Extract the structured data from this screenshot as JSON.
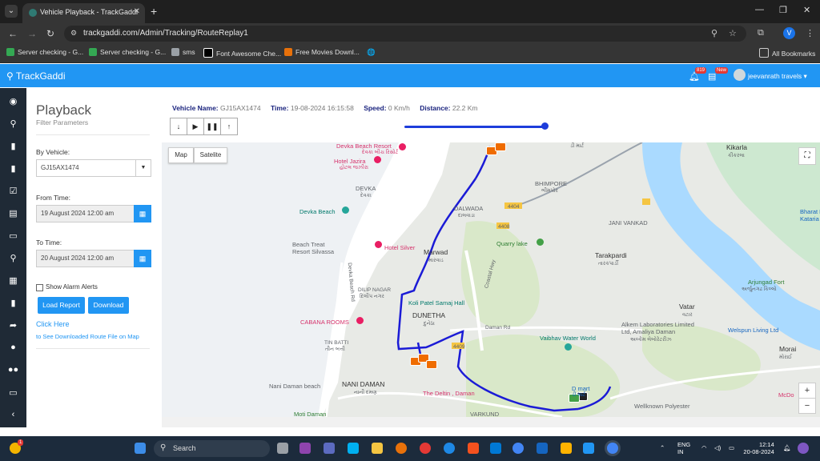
{
  "browser": {
    "tab_title": "Vehicle Playback - TrackGaddi",
    "url": "trackgaddi.com/Admin/Tracking/RouteReplay1",
    "profile_initial": "V",
    "bookmarks": [
      "Server checking - G...",
      "Server checking - G...",
      "sms",
      "Font Awesome Che...",
      "Free Movies Downl..."
    ],
    "all_bookmarks": "All Bookmarks"
  },
  "header": {
    "brand": "TrackGaddi",
    "alert_badge": "819",
    "new_badge": "New",
    "user": "jeevanrath travels"
  },
  "filter": {
    "title": "Playback",
    "subtitle": "Filter Parameters",
    "vehicle_label": "By Vehicle:",
    "vehicle_value": "GJ15AX1474",
    "from_label": "From Time:",
    "from_value": "19 August 2024 12:00 am",
    "to_label": "To Time:",
    "to_value": "20 August 2024 12:00 am",
    "alarm_label": "Show Alarm Alerts",
    "load_button": "Load Report",
    "download_button": "Download",
    "click_here": "Click Here",
    "click_here_desc": "to See Downloaded Route File on Map"
  },
  "info": {
    "vehicle_name_label": "Vehicle Name:",
    "vehicle_name": "GJ15AX1474",
    "time_label": "Time:",
    "time": "19-08-2024 16:15:58",
    "speed_label": "Speed:",
    "speed": "0 Km/h",
    "distance_label": "Distance:",
    "distance": "22.2 Km",
    "playback_progress": 1.0
  },
  "map": {
    "map_button": "Map",
    "satellite_button": "Satelite",
    "zoom_in": "+",
    "zoom_out": "−",
    "places": {
      "devka_beach_resort": "Devka Beach Resort",
      "devka_beach_resort_gu": "દેવકા બીચ રિસોર્ટ",
      "hotel_jazira": "Hotel Jazira",
      "hotel_jazira_gu": "હોટલ જઝીરા",
      "devka": "DEVKA",
      "devka_gu": "દેવકા",
      "devka_beach": "Devka Beach",
      "beach_treat": "Beach Treat",
      "resort_silvassa": "Resort Silvassa",
      "hotel_silver": "Hotel Silver",
      "dalwada": "DALWADA",
      "dalwada_gu": "દાલવાડા",
      "marwad": "Marwad",
      "marwad_gu": "મારવાડ",
      "bhimpore": "BHIMPORE",
      "bhimpore_gu": "ભીમપોર",
      "jani_vankad": "JANI VANKAD",
      "quarry_lake": "Quarry lake",
      "tarakpardi": "Tarakpardi",
      "tarakpardi_gu": "તારકપાર્ડી",
      "kikarla": "Kikarla",
      "kikarla_gu": "કીકરલા",
      "bharat_bee": "Bharat Bee",
      "kataria_truck": "Kataria Truck",
      "arjungad_fort": "Arjungad Fort",
      "arjungad_fort_gu": "અર્જુનગઢ કિલ્લો",
      "dilip_nagar": "DILIP NAGAR",
      "dilip_nagar_gu": "દિલીપ નગર",
      "koli_patel": "Koli Patel Samaj Hall",
      "dunetha": "DUNETHA",
      "dunetha_gu": "દુનેઠા",
      "daman_rd": "Daman Rd",
      "coastal_hwy": "Coastal Hwy",
      "devka_beach_rd": "Devka Beach Rd",
      "cabana_rooms": "CABANA ROOMS",
      "tin_batti": "TIN BATTI",
      "tin_batti_gu": "તીન બત્તી",
      "vaibhav_water_world": "Vaibhav Water World",
      "vatar": "Vatar",
      "vatar_gu": "વટાર",
      "alkem": "Alkem Laboratories Limited",
      "alkem2": "Ltd, Amaliya Daman",
      "alkem_gu": "અલ્કેમ લેબોરેટરીઝ",
      "welspun": "Welspun Living Ltd",
      "morai": "Morai",
      "morai_gu": "મોરાઈ",
      "nani_daman_beach": "Nani Daman beach",
      "nani_daman": "NANI DAMAN",
      "nani_daman_gu": "નાની દમણ",
      "the_deltin": "The Deltin , Daman",
      "d_mart": "D mart",
      "d_mart_gu": "ડી માર્ટ",
      "moti_daman": "Moti Daman",
      "varkund": "VARKUND",
      "wellknown": "Wellknown Polyester",
      "mcdo": "McDo",
      "dmart_top": "ડી માર્ટ",
      "road_4404": "4404",
      "road_4408": "4408",
      "road_4409": "4409"
    }
  },
  "taskbar": {
    "search": "Search",
    "lang1": "ENG",
    "lang2": "IN",
    "time": "12:14",
    "date": "20-08-2024",
    "notif_count": "1"
  }
}
